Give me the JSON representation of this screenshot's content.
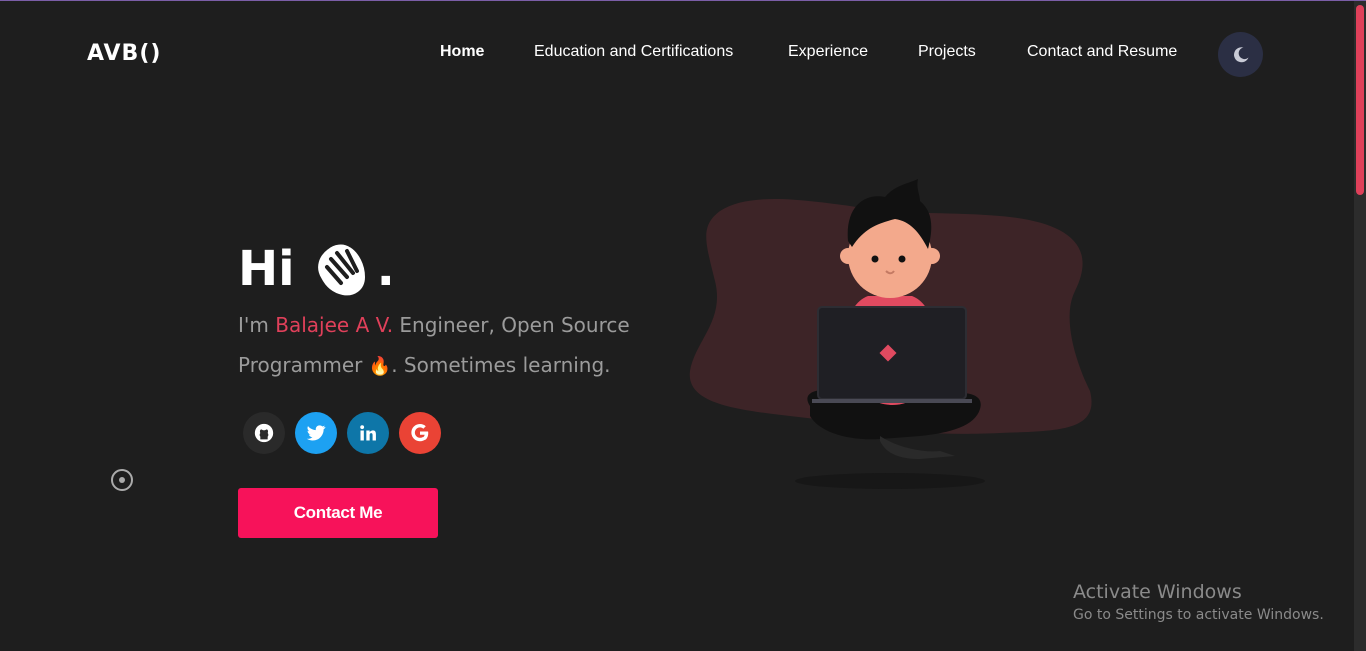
{
  "header": {
    "logo": "AVB()",
    "nav": [
      {
        "label": "Home",
        "active": true
      },
      {
        "label": "Education and Certifications",
        "active": false
      },
      {
        "label": "Experience",
        "active": false
      },
      {
        "label": "Projects",
        "active": false
      },
      {
        "label": "Contact and Resume",
        "active": false
      }
    ],
    "theme_toggle_icon": "moon-icon"
  },
  "hero": {
    "greeting": "Hi",
    "greeting_emoji_icon": "waving-hand-icon",
    "greeting_end": ".",
    "intro_prefix": "I'm ",
    "name": "Balajee A V.",
    "intro_rest": " Engineer, Open Source Programmer ",
    "fire_emoji": "🔥",
    "intro_end": ". Sometimes learning.",
    "socials": [
      {
        "icon": "github-icon",
        "color": "#2a2a2a"
      },
      {
        "icon": "twitter-icon",
        "color": "#1da1f2"
      },
      {
        "icon": "linkedin-icon",
        "color": "#0e76a8"
      },
      {
        "icon": "google-icon",
        "color": "#ea4335"
      }
    ],
    "cta_label": "Contact Me"
  },
  "colors": {
    "background": "#1e1e1e",
    "accent": "#e0405a",
    "button": "#f7125a",
    "muted_text": "#9b9b9b"
  },
  "watermark": {
    "title": "Activate Windows",
    "subtitle": "Go to Settings to activate Windows."
  }
}
